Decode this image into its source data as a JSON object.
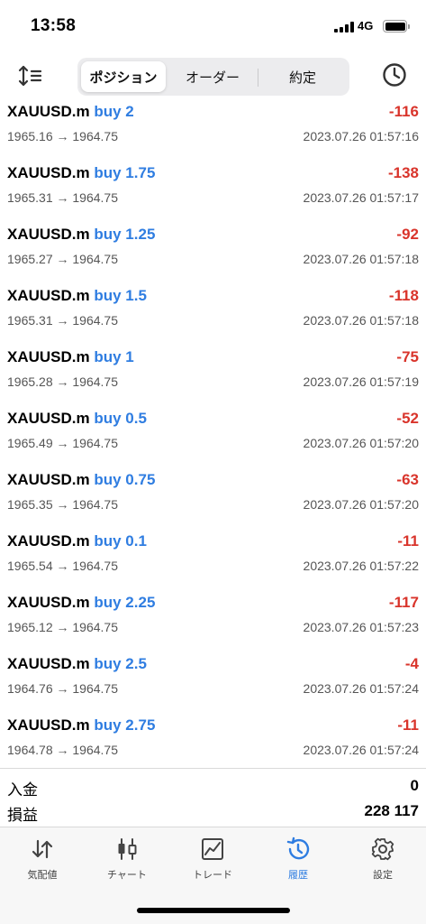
{
  "status": {
    "time": "13:58",
    "network": "4G"
  },
  "toolbar": {
    "sort_icon": "sort-icon",
    "history_icon": "clock-icon",
    "tabs": [
      {
        "label": "ポジション",
        "active": true
      },
      {
        "label": "オーダー",
        "active": false
      },
      {
        "label": "約定",
        "active": false
      }
    ]
  },
  "trades": [
    {
      "symbol": "XAUUSD.m",
      "type": "buy 2",
      "profit": "-116",
      "prices": "1965.16 → 1964.75",
      "date": "2023.07.26 01:57:16"
    },
    {
      "symbol": "XAUUSD.m",
      "type": "buy 1.75",
      "profit": "-138",
      "prices": "1965.31 → 1964.75",
      "date": "2023.07.26 01:57:17"
    },
    {
      "symbol": "XAUUSD.m",
      "type": "buy 1.25",
      "profit": "-92",
      "prices": "1965.27 → 1964.75",
      "date": "2023.07.26 01:57:18"
    },
    {
      "symbol": "XAUUSD.m",
      "type": "buy 1.5",
      "profit": "-118",
      "prices": "1965.31 → 1964.75",
      "date": "2023.07.26 01:57:18"
    },
    {
      "symbol": "XAUUSD.m",
      "type": "buy 1",
      "profit": "-75",
      "prices": "1965.28 → 1964.75",
      "date": "2023.07.26 01:57:19"
    },
    {
      "symbol": "XAUUSD.m",
      "type": "buy 0.5",
      "profit": "-52",
      "prices": "1965.49 → 1964.75",
      "date": "2023.07.26 01:57:20"
    },
    {
      "symbol": "XAUUSD.m",
      "type": "buy 0.75",
      "profit": "-63",
      "prices": "1965.35 → 1964.75",
      "date": "2023.07.26 01:57:20"
    },
    {
      "symbol": "XAUUSD.m",
      "type": "buy 0.1",
      "profit": "-11",
      "prices": "1965.54 → 1964.75",
      "date": "2023.07.26 01:57:22"
    },
    {
      "symbol": "XAUUSD.m",
      "type": "buy 2.25",
      "profit": "-117",
      "prices": "1965.12 → 1964.75",
      "date": "2023.07.26 01:57:23"
    },
    {
      "symbol": "XAUUSD.m",
      "type": "buy 2.5",
      "profit": "-4",
      "prices": "1964.76 → 1964.75",
      "date": "2023.07.26 01:57:24"
    },
    {
      "symbol": "XAUUSD.m",
      "type": "buy 2.75",
      "profit": "-11",
      "prices": "1964.78 → 1964.75",
      "date": "2023.07.26 01:57:24"
    }
  ],
  "summary": {
    "deposit_label": "入金",
    "deposit_value": "0",
    "pnl_label": "損益",
    "pnl_value": "228 117"
  },
  "tabbar": {
    "items": [
      {
        "label": "気配値",
        "icon": "quotes-arrows-icon",
        "active": false
      },
      {
        "label": "チャート",
        "icon": "candlestick-chart-icon",
        "active": false
      },
      {
        "label": "トレード",
        "icon": "trade-chart-icon",
        "active": false
      },
      {
        "label": "履歴",
        "icon": "history-clock-icon",
        "active": true
      },
      {
        "label": "設定",
        "icon": "gear-icon",
        "active": false
      }
    ]
  },
  "colors": {
    "accent": "#2f7de1",
    "loss": "#d9342b"
  }
}
